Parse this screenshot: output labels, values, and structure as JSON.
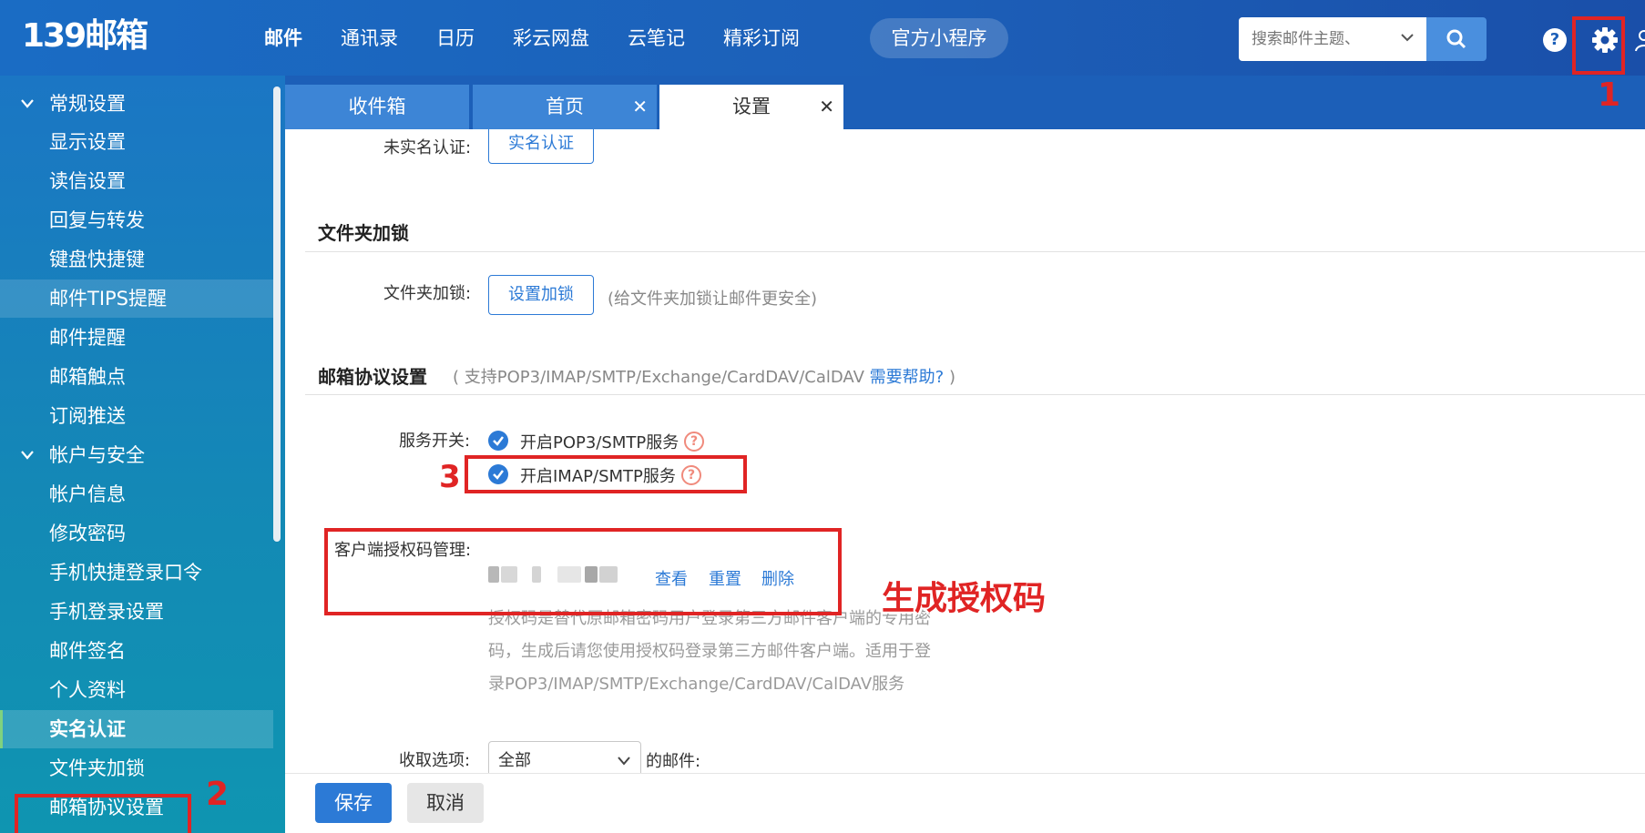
{
  "header": {
    "logo": "139邮箱",
    "nav": [
      "邮件",
      "通讯录",
      "日历",
      "彩云网盘",
      "云笔记",
      "精彩订阅"
    ],
    "mini_program": "官方小程序",
    "search_placeholder": "搜索邮件主题、",
    "help": "?"
  },
  "sidebar": {
    "groups": [
      {
        "label": "常规设置",
        "items": [
          "显示设置",
          "读信设置",
          "回复与转发",
          "键盘快捷键",
          "邮件TIPS提醒",
          "邮件提醒",
          "邮箱触点",
          "订阅推送"
        ]
      },
      {
        "label": "帐户与安全",
        "items": [
          "帐户信息",
          "修改密码",
          "手机快捷登录口令",
          "手机登录设置",
          "邮件签名",
          "个人资料",
          "实名认证",
          "文件夹加锁",
          "邮箱协议设置"
        ]
      }
    ]
  },
  "tabs": [
    {
      "label": "收件箱",
      "closable": false
    },
    {
      "label": "首页",
      "closable": true
    },
    {
      "label": "设置",
      "closable": true,
      "active": true
    }
  ],
  "content": {
    "realname": {
      "label": "未实名认证:",
      "button": "实名认证"
    },
    "folder_lock": {
      "title": "文件夹加锁",
      "label": "文件夹加锁:",
      "button": "设置加锁",
      "hint": "(给文件夹加锁让邮件更安全)"
    },
    "protocol": {
      "title": "邮箱协议设置",
      "subtitle": "( 支持POP3/IMAP/SMTP/Exchange/CardDAV/CalDAV",
      "help_link": "需要帮助?",
      "subtitle_close": ")",
      "service_label": "服务开关:",
      "services": [
        "开启POP3/SMTP服务",
        "开启IMAP/SMTP服务"
      ],
      "auth_label": "客户端授权码管理:",
      "actions": [
        "查看",
        "重置",
        "删除"
      ],
      "desc_lines": [
        "授权码是替代原邮箱密码用户登录第三方邮件客户端的专用密",
        "码，生成后请您使用授权码登录第三方邮件客户端。适用于登",
        "录POP3/IMAP/SMTP/Exchange/CardDAV/CalDAV服务"
      ],
      "fetch_label": "收取选项:",
      "fetch_value": "全部",
      "fetch_suffix": "的邮件:"
    }
  },
  "footer": {
    "save": "保存",
    "cancel": "取消"
  },
  "annotations": {
    "n1": "1",
    "n2": "2",
    "n3": "3",
    "generate": "生成授权码",
    "color": "#e02424"
  },
  "colors": {
    "brand": "#1c5fb8",
    "accent": "#2c7ad6",
    "sidebar": "#138ab5"
  }
}
